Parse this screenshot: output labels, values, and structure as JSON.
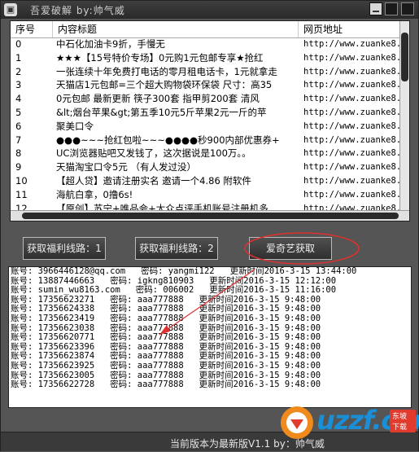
{
  "window": {
    "title": "吾爱破解 by:帅气威"
  },
  "list": {
    "columns": [
      "序号",
      "内容标题",
      "网页地址"
    ],
    "rows": [
      [
        "0",
        "中石化加油卡9折，手慢无",
        "http://www.zuanke8.c"
      ],
      [
        "1",
        "★★★【15号特价专场】0元购1元包邮专享★抢红",
        "http://www.zuanke8.c"
      ],
      [
        "2",
        "一张连续十年免费打电话的零月租电话卡，1元就拿走",
        "http://www.zuanke8.c"
      ],
      [
        "3",
        "天猫店1元包邮=三个超大购物袋环保袋 尺寸：高35",
        "http://www.zuanke8.c"
      ],
      [
        "4",
        "0元包邮  最新更新 筷子300套 指甲剪200套 清风",
        "http://www.zuanke8.c"
      ],
      [
        "5",
        "&lt;烟台苹果&gt;第五季10元5斤苹果2元一斤的苹",
        "http://www.zuanke8.c"
      ],
      [
        "6",
        "聚美口令",
        "http://www.zuanke8.c"
      ],
      [
        "7",
        "●●●~~~抢红包啦~~~●●●●秒900内部优惠券+",
        "http://www.zuanke8.c"
      ],
      [
        "8",
        "UC浏览器贴吧又发钱了，这次据说是100万。。",
        "http://www.zuanke8.c"
      ],
      [
        "9",
        "天猫淘宝口令5元 （有人发过没）",
        "http://www.zuanke8.c"
      ],
      [
        "10",
        "【超人贷】邀请注册实名  邀请一个4.86 附软件",
        "http://www.zuanke8.c"
      ],
      [
        "11",
        "海航白拿，0撸6s!",
        "http://www.zuanke8.c"
      ],
      [
        "12",
        "【原创】苏宁+唯品会+大众点评手机账号注册机多",
        "http://www.zuanke8.c"
      ]
    ]
  },
  "buttons": {
    "btn1": "获取福利线路：1",
    "btn2": "获取福利线路：2",
    "btn3": "爱奇艺获取"
  },
  "log": [
    "账号: 3966446128@qq.com   密码: yangmi122   更新时间2016-3-15 13:44:00",
    "账号: 13887446663   密码: igkng810903   更新时间2016-3-15 12:12:00",
    "账号: sumin_wu8163.com   密码: 006002   更新时间2016-3-15 11:16:00",
    "账号: 17356623271   密码: aaa777888   更新时间2016-3-15 9:48:00",
    "账号: 17356624338   密码: aaa777888   更新时间2016-3-15 9:48:00",
    "账号: 17356623419   密码: aaa777888   更新时间2016-3-15 9:48:00",
    "账号: 17356623038   密码: aaa777888   更新时间2016-3-15 9:48:00",
    "账号: 17356620771   密码: aaa777888   更新时间2016-3-15 9:48:00",
    "账号: 17356623396   密码: aaa777888   更新时间2016-3-15 9:48:00",
    "账号: 17356623874   密码: aaa777888   更新时间2016-3-15 9:48:00",
    "账号: 17356623925   密码: aaa777888   更新时间2016-3-15 9:48:00",
    "账号: 17356623005   密码: aaa777888   更新时间2016-3-15 9:48:00",
    "账号: 17356622728   密码: aaa777888   更新时间2016-3-15 9:48:00"
  ],
  "status": {
    "text": "当前版本为最新版V1.1  by：帅气威"
  },
  "watermark": {
    "text": "uzzf.com",
    "badge": "东坡下载"
  },
  "colors": {
    "annotation": "#e03030",
    "watermark": "#1b8fd6"
  }
}
